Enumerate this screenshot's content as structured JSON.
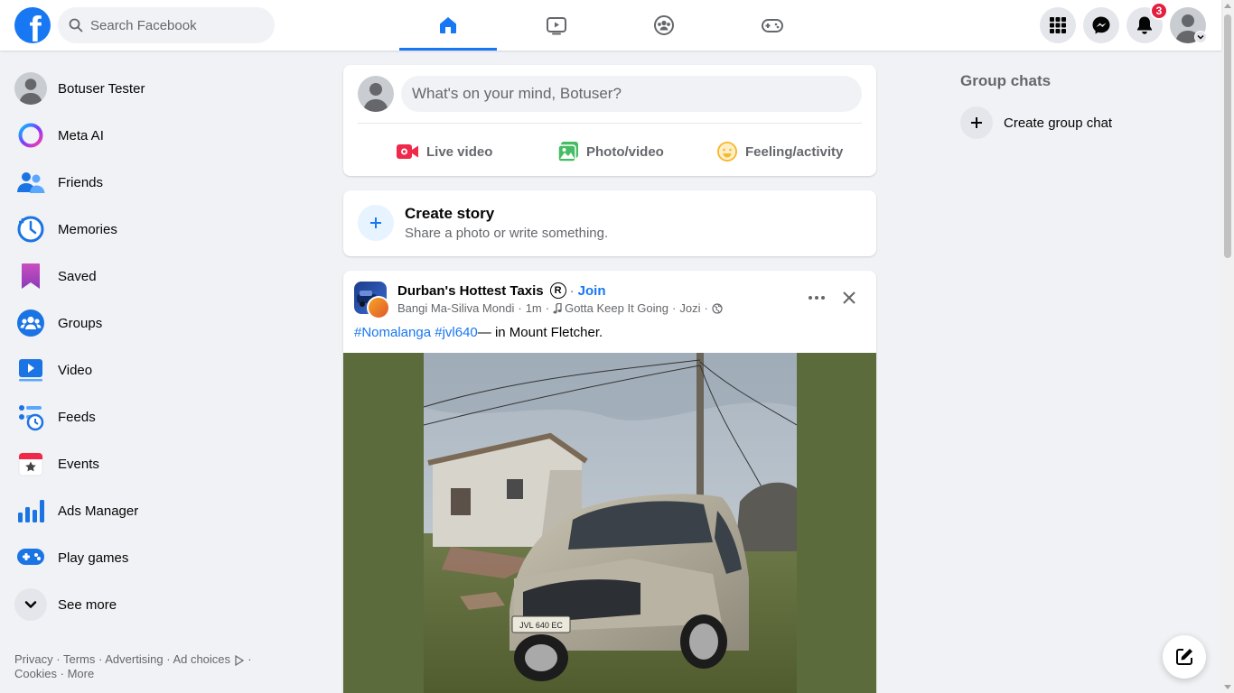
{
  "topbar": {
    "logo_letter": "f",
    "search_placeholder": "Search Facebook",
    "nav_tabs": [
      {
        "icon": "home-icon",
        "active": true
      },
      {
        "icon": "video-icon",
        "active": false
      },
      {
        "icon": "groups-icon",
        "active": false
      },
      {
        "icon": "gaming-icon",
        "active": false
      }
    ],
    "notification_count": "3"
  },
  "sidebar": {
    "items": [
      {
        "label": "Botuser Tester",
        "icon": "profile-avatar"
      },
      {
        "label": "Meta AI",
        "icon": "meta-ai-icon"
      },
      {
        "label": "Friends",
        "icon": "friends-icon"
      },
      {
        "label": "Memories",
        "icon": "memories-icon"
      },
      {
        "label": "Saved",
        "icon": "saved-icon"
      },
      {
        "label": "Groups",
        "icon": "groups-icon"
      },
      {
        "label": "Video",
        "icon": "video-icon"
      },
      {
        "label": "Feeds",
        "icon": "feeds-icon"
      },
      {
        "label": "Events",
        "icon": "events-icon"
      },
      {
        "label": "Ads Manager",
        "icon": "ads-manager-icon"
      },
      {
        "label": "Play games",
        "icon": "play-games-icon"
      },
      {
        "label": "See more",
        "icon": "chevron-down-icon"
      }
    ],
    "footer": {
      "privacy": "Privacy",
      "terms": "Terms",
      "advertising": "Advertising",
      "ad_choices": "Ad choices",
      "cookies": "Cookies",
      "more": "More",
      "sep": "·"
    }
  },
  "composer": {
    "placeholder": "What's on your mind, Botuser?",
    "actions": [
      {
        "label": "Live video",
        "icon": "live-video-icon",
        "color": "#f02849"
      },
      {
        "label": "Photo/video",
        "icon": "photo-video-icon",
        "color": "#45bd62"
      },
      {
        "label": "Feeling/activity",
        "icon": "feeling-icon",
        "color": "#f7b928"
      }
    ]
  },
  "story": {
    "title": "Create story",
    "subtitle": "Share a photo or write something."
  },
  "post": {
    "group_name": "Durban's Hottest Taxis",
    "registered_mark": "R",
    "join_label": "Join",
    "author": "Bangi Ma-Siliva Mondi",
    "time": "1m",
    "music": "Gotta Keep It Going",
    "location_tag": "Jozi",
    "hashtag1": "#Nomalanga",
    "hashtag2": "#jvl640",
    "text_suffix": "— in ",
    "place": "Mount Fletcher.",
    "plate_text": "JVL 640 EC"
  },
  "right": {
    "group_chats_title": "Group chats",
    "create_group_chat": "Create group chat"
  },
  "colors": {
    "brand": "#1877f2",
    "badge": "#e41e3f",
    "media_bg": "#5c6b3b"
  }
}
